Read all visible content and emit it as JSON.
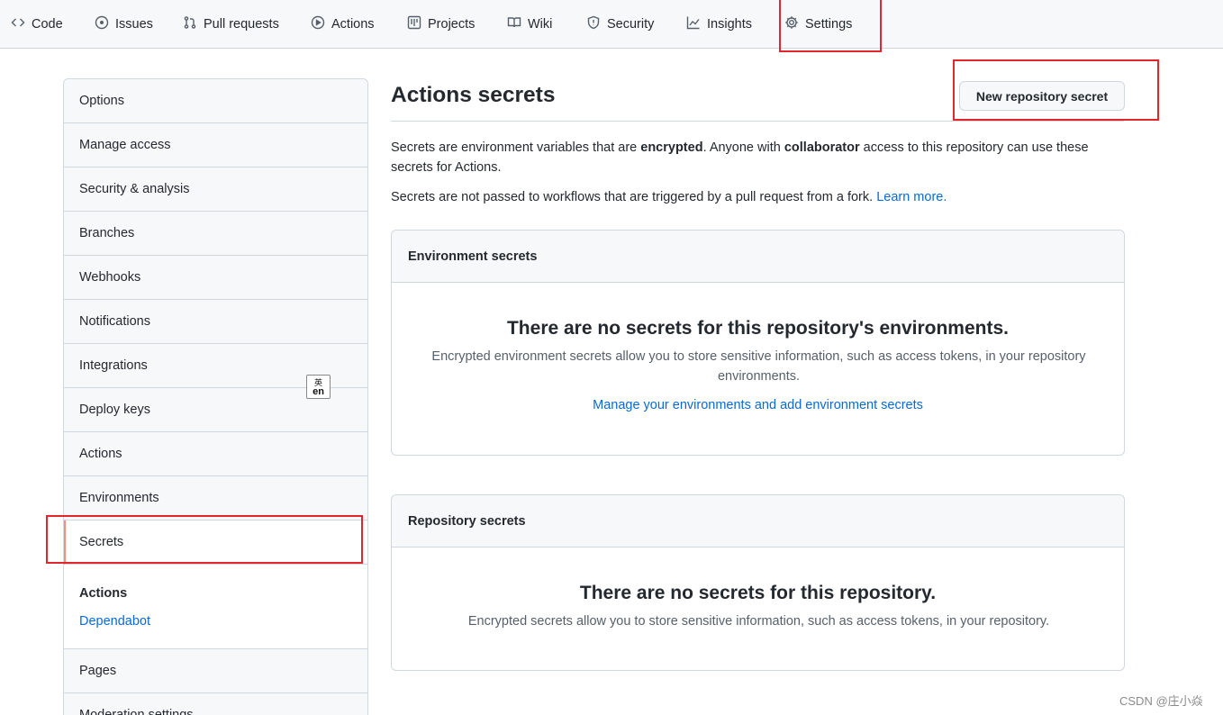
{
  "nav": {
    "tabs": [
      {
        "label": "Code",
        "icon": "code-icon"
      },
      {
        "label": "Issues",
        "icon": "issue-opened-icon"
      },
      {
        "label": "Pull requests",
        "icon": "git-pull-request-icon"
      },
      {
        "label": "Actions",
        "icon": "play-icon"
      },
      {
        "label": "Projects",
        "icon": "table-icon"
      },
      {
        "label": "Wiki",
        "icon": "book-icon"
      },
      {
        "label": "Security",
        "icon": "shield-icon"
      },
      {
        "label": "Insights",
        "icon": "graph-icon"
      },
      {
        "label": "Settings",
        "icon": "gear-icon"
      }
    ]
  },
  "sidebar": {
    "items": [
      {
        "label": "Options"
      },
      {
        "label": "Manage access"
      },
      {
        "label": "Security & analysis"
      },
      {
        "label": "Branches"
      },
      {
        "label": "Webhooks"
      },
      {
        "label": "Notifications"
      },
      {
        "label": "Integrations"
      },
      {
        "label": "Deploy keys"
      },
      {
        "label": "Actions"
      },
      {
        "label": "Environments"
      },
      {
        "label": "Secrets",
        "selected": true
      }
    ],
    "subsection": {
      "heading": "Actions",
      "link": "Dependabot"
    },
    "after": [
      {
        "label": "Pages"
      },
      {
        "label": "Moderation settings"
      }
    ]
  },
  "ime": {
    "top": "英",
    "bottom": "en"
  },
  "main": {
    "title": "Actions secrets",
    "new_button": "New repository secret",
    "intro": {
      "p1_a": "Secrets are environment variables that are ",
      "p1_b": "encrypted",
      "p1_c": ". Anyone with ",
      "p1_d": "collaborator",
      "p1_e": " access to this repository can use these secrets for Actions.",
      "p2": "Secrets are not passed to workflows that are triggered by a pull request from a fork. ",
      "p2_link": "Learn more."
    },
    "env_box": {
      "header": "Environment secrets",
      "title": "There are no secrets for this repository's environments.",
      "text": "Encrypted environment secrets allow you to store sensitive information, such as access tokens, in your repository environments.",
      "link": "Manage your environments and add environment secrets"
    },
    "repo_box": {
      "header": "Repository secrets",
      "title": "There are no secrets for this repository.",
      "text": "Encrypted secrets allow you to store sensitive information, such as access tokens, in your repository."
    }
  },
  "watermark": "CSDN @庄小焱",
  "colors": {
    "accent": "#0969da",
    "annotation": "#e3262b",
    "selected_marker": "#fd8c73"
  }
}
